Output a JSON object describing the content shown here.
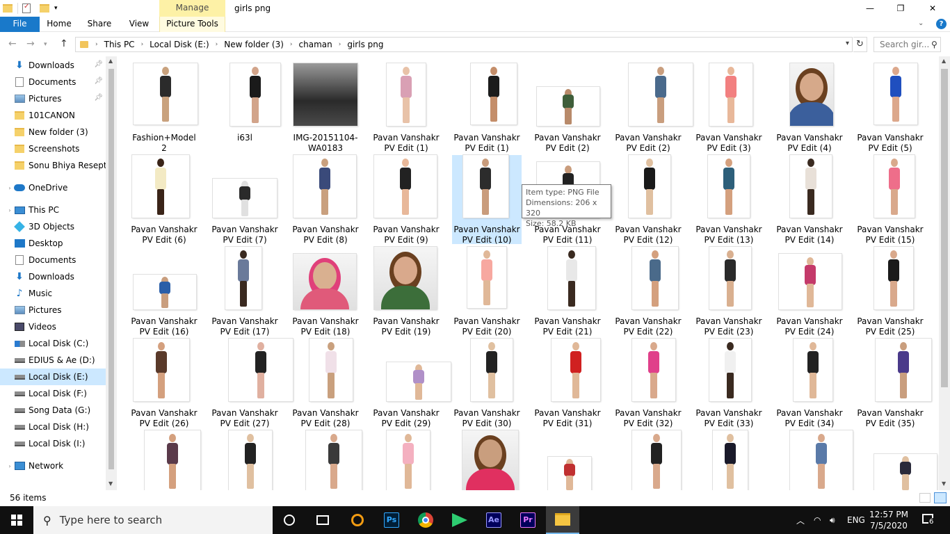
{
  "titlebar": {
    "manage_label": "Manage",
    "title": "girls png",
    "minimize": "—",
    "maximize": "❐",
    "close": "✕"
  },
  "ribbon": {
    "tabs": [
      "File",
      "Home",
      "Share",
      "View",
      "Picture Tools"
    ]
  },
  "address": {
    "crumbs": [
      "This PC",
      "Local Disk (E:)",
      "New folder (3)",
      "chaman",
      "girls png"
    ]
  },
  "search": {
    "placeholder": "Search gir..."
  },
  "sidebar": {
    "items": [
      {
        "label": "Downloads",
        "icon": "download-icon",
        "pinned": true
      },
      {
        "label": "Documents",
        "icon": "documents-icon",
        "pinned": true
      },
      {
        "label": "Pictures",
        "icon": "pictures-icon",
        "pinned": true
      },
      {
        "label": "101CANON",
        "icon": "folder-icon"
      },
      {
        "label": "New folder (3)",
        "icon": "folder-icon"
      },
      {
        "label": "Screenshots",
        "icon": "folder-icon"
      },
      {
        "label": "Sonu Bhiya Resept",
        "icon": "folder-icon"
      },
      {
        "label": "OneDrive",
        "icon": "onedrive-icon"
      },
      {
        "label": "This PC",
        "icon": "this-pc-icon"
      },
      {
        "label": "3D Objects",
        "icon": "3d-objects-icon"
      },
      {
        "label": "Desktop",
        "icon": "desktop-icon"
      },
      {
        "label": "Documents",
        "icon": "documents-icon"
      },
      {
        "label": "Downloads",
        "icon": "download-icon"
      },
      {
        "label": "Music",
        "icon": "music-icon"
      },
      {
        "label": "Pictures",
        "icon": "pictures-icon"
      },
      {
        "label": "Videos",
        "icon": "videos-icon"
      },
      {
        "label": "Local Disk (C:)",
        "icon": "windows-drive-icon"
      },
      {
        "label": "EDIUS & Ae (D:)",
        "icon": "drive-icon"
      },
      {
        "label": "Local Disk (E:)",
        "icon": "drive-icon",
        "selected": true
      },
      {
        "label": "Local Disk (F:)",
        "icon": "drive-icon"
      },
      {
        "label": "Song Data (G:)",
        "icon": "drive-icon"
      },
      {
        "label": "Local Disk (H:)",
        "icon": "drive-icon"
      },
      {
        "label": "Local Disk (I:)",
        "icon": "drive-icon"
      },
      {
        "label": "Network",
        "icon": "network-icon"
      }
    ]
  },
  "files": [
    "Fashion+Model2",
    "i63l",
    "IMG-20151104-WA0183",
    "Pavan Vanshakr PV Edit (1)",
    "Pavan Vanshakr PV Edit (1)",
    "Pavan Vanshakr PV Edit (2)",
    "Pavan Vanshakr PV Edit (2)",
    "Pavan Vanshakr PV Edit (3)",
    "Pavan Vanshakr PV Edit (4)",
    "Pavan Vanshakr PV Edit (5)",
    "Pavan Vanshakr PV Edit (6)",
    "Pavan Vanshakr PV Edit (7)",
    "Pavan Vanshakr PV Edit (8)",
    "Pavan Vanshakr PV Edit (9)",
    "Pavan Vanshakr PV Edit (10)",
    "Pavan Vanshakr PV Edit (11)",
    "Pavan Vanshakr PV Edit (12)",
    "Pavan Vanshakr PV Edit (13)",
    "Pavan Vanshakr PV Edit (14)",
    "Pavan Vanshakr PV Edit (15)",
    "Pavan Vanshakr PV Edit (16)",
    "Pavan Vanshakr PV Edit (17)",
    "Pavan Vanshakr PV Edit (18)",
    "Pavan Vanshakr PV Edit (19)",
    "Pavan Vanshakr PV Edit (20)",
    "Pavan Vanshakr PV Edit (21)",
    "Pavan Vanshakr PV Edit (22)",
    "Pavan Vanshakr PV Edit (23)",
    "Pavan Vanshakr PV Edit (24)",
    "Pavan Vanshakr PV Edit (25)",
    "Pavan Vanshakr PV Edit (26)",
    "Pavan Vanshakr PV Edit (27)",
    "Pavan Vanshakr PV Edit (28)",
    "Pavan Vanshakr PV Edit (29)",
    "Pavan Vanshakr PV Edit (30)",
    "Pavan Vanshakr PV Edit (31)",
    "Pavan Vanshakr PV Edit (32)",
    "Pavan Vanshakr PV Edit (33)",
    "Pavan Vanshakr PV Edit (34)",
    "Pavan Vanshakr PV Edit (35)",
    "",
    "",
    "",
    "",
    "",
    "",
    "",
    "",
    "",
    ""
  ],
  "selected_file_index": 14,
  "tooltip": {
    "type": "Item type: PNG File",
    "dimensions": "Dimensions: 206 x 320",
    "size": "Size: 58.2 KB"
  },
  "status": {
    "count": "56 items"
  },
  "taskbar": {
    "search_text": "Type here to search",
    "apps": [
      "cortana-icon",
      "task-view-icon",
      "search-app-icon",
      "photoshop-icon",
      "chrome-icon",
      "filmora-icon",
      "after-effects-icon",
      "premiere-icon",
      "file-explorer-icon"
    ],
    "ps_label": "Ps",
    "ae_label": "Ae",
    "pr_label": "Pr",
    "language": "ENG",
    "time": "12:57 PM",
    "date": "7/5/2020",
    "notifications": "6"
  },
  "colors": {
    "accent": "#1979ca",
    "manage_bg": "#fdf1a6",
    "selection": "#cce8ff",
    "taskbar": "#101010"
  }
}
